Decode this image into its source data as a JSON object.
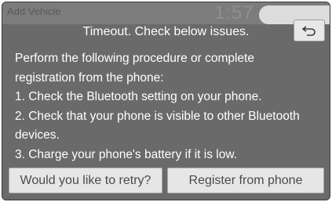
{
  "status_bar": {
    "left_text": "Add  Vehicle",
    "clock": "1:57"
  },
  "dialog": {
    "title": "Timeout. Check below issues.",
    "back_icon": "back-arrow-icon",
    "body_lines": [
      "Perform the following procedure or complete",
      "registration from the phone:",
      "1. Check the Bluetooth setting on your phone.",
      "2. Check that your phone is visible to other Bluetooth",
      "devices.",
      "3. Charge your phone's battery if it is low."
    ],
    "buttons": {
      "retry_label": "Would you like to retry?",
      "register_label": "Register from phone"
    }
  },
  "colors": {
    "dialog_background": "#6a6a6a",
    "button_background": "#e6e6e6",
    "text_primary": "#ffffff"
  }
}
